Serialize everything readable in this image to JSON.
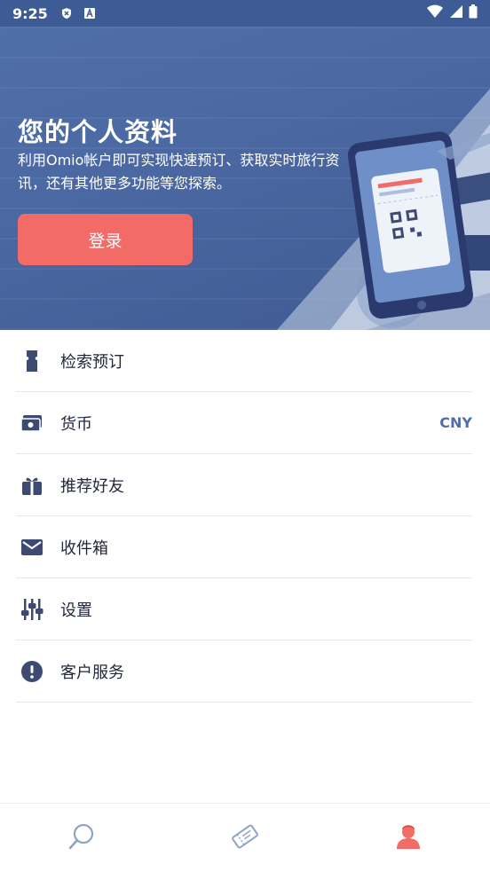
{
  "status_bar": {
    "time": "9:25",
    "icons": [
      "shield-icon",
      "a-icon",
      "wifi-icon",
      "signal-icon",
      "battery-icon"
    ]
  },
  "header": {
    "title": "您的个人资料",
    "description": "利用Omio帐户即可实现快速预订、获取实时旅行资讯，还有其他更多功能等您探索。",
    "login_label": "登录"
  },
  "menu": {
    "items": [
      {
        "label": "检索预订",
        "icon": "ticket-icon"
      },
      {
        "label": "货币",
        "icon": "wallet-icon",
        "value": "CNY"
      },
      {
        "label": "推荐好友",
        "icon": "gift-icon"
      },
      {
        "label": "收件箱",
        "icon": "mail-icon"
      },
      {
        "label": "设置",
        "icon": "sliders-icon"
      },
      {
        "label": "客户服务",
        "icon": "alert-icon"
      }
    ]
  },
  "bottom_nav": {
    "items": [
      {
        "icon": "search-icon",
        "active": false
      },
      {
        "icon": "tickets-icon",
        "active": false
      },
      {
        "icon": "profile-icon",
        "active": true
      }
    ]
  },
  "colors": {
    "header_bg": "#4a67a1",
    "accent": "#f26b66",
    "icon": "#3d4a72",
    "currency_text": "#4f6fa9"
  }
}
